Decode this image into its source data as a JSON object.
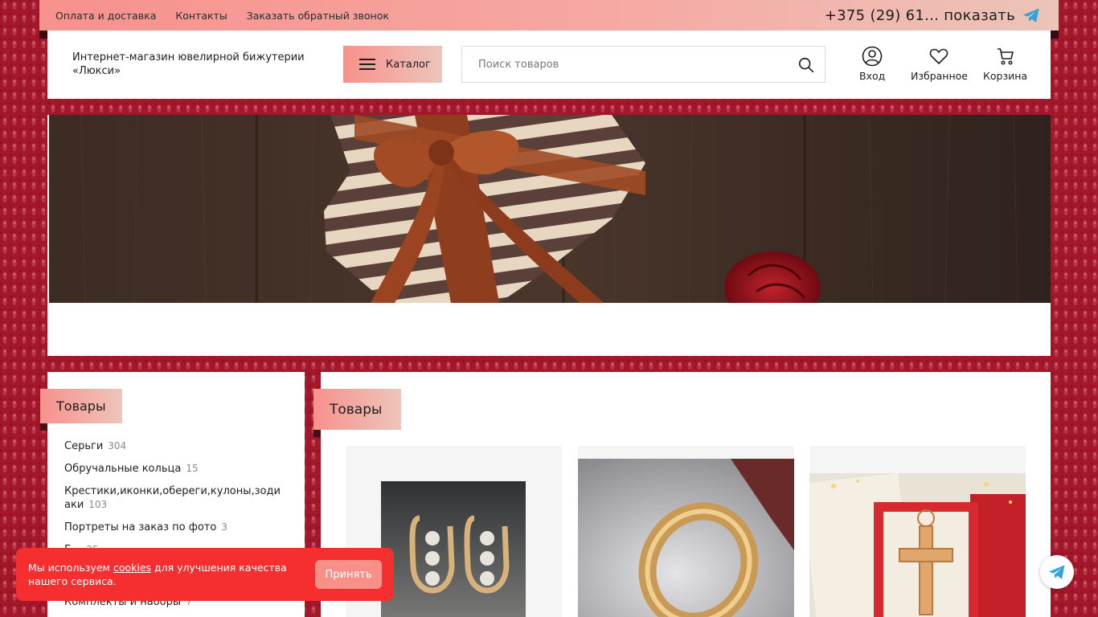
{
  "topbar": {
    "links": [
      "Оплата и доставка",
      "Контакты",
      "Заказать обратный звонок"
    ],
    "phone": "+375 (29) 61... показать",
    "phone_icon": "telegram-icon"
  },
  "header": {
    "brand": "Интернет-магазин ювелирной бижутерии «Люкси»",
    "catalog_label": "Каталог",
    "search_placeholder": "Поиск товаров",
    "login_label": "Вход",
    "favorites_label": "Избранное",
    "cart_label": "Корзина"
  },
  "sidebar": {
    "title": "Товары",
    "categories": [
      {
        "name": "Серьги",
        "count": "304"
      },
      {
        "name": "Обручальные кольца",
        "count": "15"
      },
      {
        "name": "Крестики,иконки,обереги,кулоны,зодиаки",
        "count": "103"
      },
      {
        "name": "Портреты на заказ по фото",
        "count": "3"
      },
      {
        "name": "Б...",
        "count": "25"
      },
      {
        "name": "Комплекты и наборы",
        "count": "7"
      }
    ]
  },
  "main": {
    "title": "Товары"
  },
  "cookie": {
    "text_before": "Мы используем ",
    "link": "cookies",
    "text_after": " для улучшения качества нашего сервиса.",
    "accept": "Принять"
  },
  "colors": {
    "accent_gradient_start": "#f7918c",
    "accent_gradient_end": "#edc5ba",
    "cookie_bg": "#f52f2f",
    "page_bg": "#a3172a",
    "telegram": "#2ea6da"
  }
}
